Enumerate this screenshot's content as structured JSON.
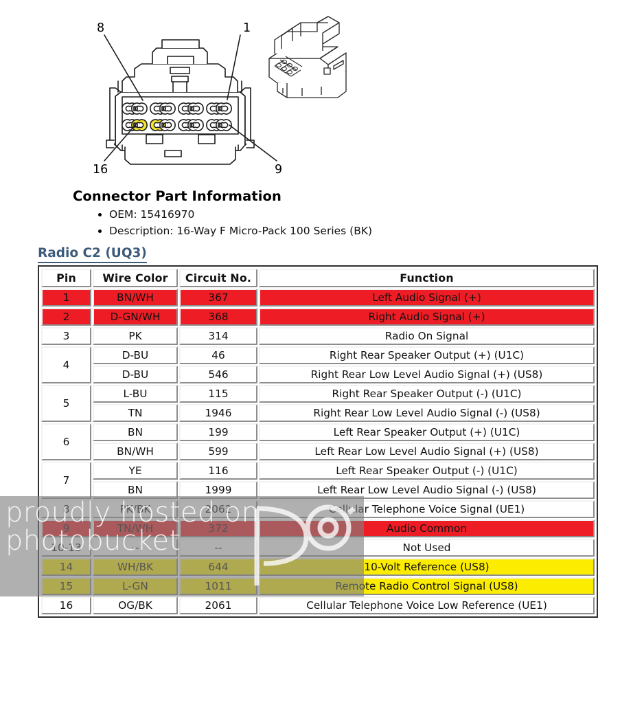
{
  "diagram": {
    "name": "16-way-connector-pinout",
    "callouts": [
      {
        "label": "8",
        "id": "callout-8"
      },
      {
        "label": "1",
        "id": "callout-1"
      },
      {
        "label": "16",
        "id": "callout-16"
      },
      {
        "label": "9",
        "id": "callout-9"
      }
    ],
    "highlight_color": "#f2e431",
    "cavity_rows": 2,
    "cavities_per_row": 8,
    "highlighted_cavities": [
      2,
      3
    ]
  },
  "part_info": {
    "title": "Connector Part Information",
    "items": [
      "OEM: 15416970",
      "Description: 16-Way F Micro-Pack 100 Series (BK)"
    ]
  },
  "section": {
    "heading": "Radio C2 (UQ3)",
    "heading_color": "#3c5a7a"
  },
  "table": {
    "headers": {
      "pin": "Pin",
      "wire_color": "Wire Color",
      "circuit_no": "Circuit No.",
      "function": "Function"
    },
    "highlight_colors": {
      "red": "#ee1d25",
      "yellow": "#fbec00"
    },
    "rows": [
      {
        "pin": "1",
        "wire": "BN/WH",
        "ckt": "367",
        "fn": "Left Audio Signal (+)",
        "hl": "red",
        "rowspan": 1,
        "pin_skip": false
      },
      {
        "pin": "2",
        "wire": "D-GN/WH",
        "ckt": "368",
        "fn": "Right Audio Signal (+)",
        "hl": "red",
        "rowspan": 1,
        "pin_skip": false
      },
      {
        "pin": "3",
        "wire": "PK",
        "ckt": "314",
        "fn": "Radio On Signal",
        "hl": "none",
        "rowspan": 1,
        "pin_skip": false
      },
      {
        "pin": "4",
        "wire": "D-BU",
        "ckt": "46",
        "fn": "Right Rear Speaker Output (+) (U1C)",
        "hl": "none",
        "rowspan": 2,
        "pin_skip": false
      },
      {
        "pin": "",
        "wire": "D-BU",
        "ckt": "546",
        "fn": "Right Rear Low Level Audio Signal (+) (US8)",
        "hl": "none",
        "rowspan": 0,
        "pin_skip": true
      },
      {
        "pin": "5",
        "wire": "L-BU",
        "ckt": "115",
        "fn": "Right Rear Speaker Output (-) (U1C)",
        "hl": "none",
        "rowspan": 2,
        "pin_skip": false
      },
      {
        "pin": "",
        "wire": "TN",
        "ckt": "1946",
        "fn": "Right Rear Low Level Audio Signal (-) (US8)",
        "hl": "none",
        "rowspan": 0,
        "pin_skip": true
      },
      {
        "pin": "6",
        "wire": "BN",
        "ckt": "199",
        "fn": "Left Rear Speaker Output (+) (U1C)",
        "hl": "none",
        "rowspan": 2,
        "pin_skip": false
      },
      {
        "pin": "",
        "wire": "BN/WH",
        "ckt": "599",
        "fn": "Left Rear Low Level Audio Signal (+) (US8)",
        "hl": "none",
        "rowspan": 0,
        "pin_skip": true
      },
      {
        "pin": "7",
        "wire": "YE",
        "ckt": "116",
        "fn": "Left Rear Speaker Output (-) (U1C)",
        "hl": "none",
        "rowspan": 2,
        "pin_skip": false
      },
      {
        "pin": "",
        "wire": "BN",
        "ckt": "1999",
        "fn": "Left Rear Low Level Audio Signal (-) (US8)",
        "hl": "none",
        "rowspan": 0,
        "pin_skip": true
      },
      {
        "pin": "8",
        "wire": "PK/BK",
        "ckt": "2062",
        "fn": "Cellular Telephone Voice Signal (UE1)",
        "hl": "none",
        "rowspan": 1,
        "pin_skip": false
      },
      {
        "pin": "9",
        "wire": "TN/WH",
        "ckt": "372",
        "fn": "Audio Common",
        "hl": "red",
        "rowspan": 1,
        "pin_skip": false
      },
      {
        "pin": "10-13",
        "wire": "--",
        "ckt": "--",
        "fn": "Not Used",
        "hl": "none",
        "rowspan": 1,
        "pin_skip": false
      },
      {
        "pin": "14",
        "wire": "WH/BK",
        "ckt": "644",
        "fn": "10-Volt Reference (US8)",
        "hl": "yellow",
        "rowspan": 1,
        "pin_skip": false
      },
      {
        "pin": "15",
        "wire": "L-GN",
        "ckt": "1011",
        "fn": "Remote Radio Control Signal (US8)",
        "hl": "yellow",
        "rowspan": 1,
        "pin_skip": false
      },
      {
        "pin": "16",
        "wire": "OG/BK",
        "ckt": "2061",
        "fn": "Cellular Telephone Voice Low Reference (UE1)",
        "hl": "none",
        "rowspan": 1,
        "pin_skip": false
      }
    ]
  },
  "watermark": {
    "line1": "proudly hosted on",
    "line2": "photobucket"
  }
}
